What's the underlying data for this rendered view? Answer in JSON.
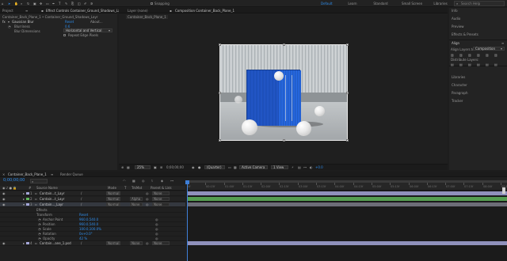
{
  "colors": {
    "accent": "#2d8ceb",
    "bg": "#1d1d1d",
    "panel": "#232323",
    "container_blue": "#1f56c4",
    "layer_green": "#5fb55a",
    "layer_purple": "#a4a6d8",
    "track_gray": "#6d6d78",
    "playhead": "#3e7fd8"
  },
  "top_toolbar": {
    "tools": [
      "home-icon",
      "selection-tool-icon",
      "hand-tool-icon",
      "zoom-tool-icon",
      "rotate-tool-icon",
      "camera-tool-icon",
      "pan-behind-tool-icon",
      "rectangle-tool-icon",
      "pen-tool-icon",
      "type-tool-icon",
      "brush-tool-icon",
      "clone-stamp-tool-icon",
      "eraser-tool-icon",
      "roto-brush-tool-icon",
      "puppet-tool-icon"
    ],
    "snapping_label": "Snapping",
    "workspaces": [
      "Default",
      "Learn",
      "Standard",
      "Small Screen",
      "Libraries"
    ],
    "search_label": "Search Help"
  },
  "left_panel": {
    "tabs": [
      "Project",
      "Effect Controls Container_Ground_Shadows_Layr"
    ],
    "breadcrumb": "Container_Back_Plane_1 • Container_Ground_Shadows_Layr",
    "effect": {
      "name": "Gaussian Blur",
      "reset": "Reset",
      "about": "About...",
      "params": [
        {
          "label": "Blurriness",
          "value": "0.6"
        },
        {
          "label": "Blur Dimensions",
          "value": "Horizontal and Vertical"
        }
      ],
      "checkbox_label": "Repeat Edge Pixels"
    }
  },
  "center_panel": {
    "tabs": [
      "Layer (none)",
      "Composition Container_Back_Plane_1"
    ],
    "sub_tab": "Container_Back_Plane_1",
    "bottom_bar": {
      "zoom": "25%",
      "timecode": "0;00;00;00",
      "resolution": "(Quarter)",
      "camera": "Active Camera",
      "views": "1 View",
      "exposure": "+0.0"
    }
  },
  "right_panel": {
    "items_top": [
      "Info",
      "Audio",
      "Preview",
      "Effects & Presets"
    ],
    "align": {
      "title": "Align",
      "align_layers_to_label": "Align Layers to:",
      "align_layers_to_value": "Composition",
      "distribute_label": "Distribute Layers:"
    },
    "items_bottom": [
      "Libraries",
      "Character",
      "Paragraph",
      "Tracker"
    ]
  },
  "timeline": {
    "tabs": [
      "Container_Back_Plane_1",
      "Render Queue"
    ],
    "timecode": "0;00;00;00",
    "search_placeholder": "",
    "columns": [
      "#",
      "Source Name",
      "Mode",
      "T",
      "TrkMat",
      "Parent & Link"
    ],
    "layers": [
      {
        "num": "1",
        "name": "Contain...t_Layr",
        "mode": "Normal",
        "trkmat": "",
        "parent": "None",
        "color": "#a4a6d8"
      },
      {
        "num": "2",
        "name": "Contain...t_Layr",
        "mode": "Normal",
        "trkmat": "Alpha",
        "parent": "None",
        "color": "#5fb55a"
      },
      {
        "num": "3",
        "name": "Contain..._Layr",
        "mode": "Normal",
        "trkmat": "None",
        "parent": "None",
        "color": "#a4a6d8"
      }
    ],
    "effects_label": "Effects",
    "transform": {
      "label": "Transform",
      "reset": "Reset",
      "props": [
        {
          "label": "Anchor Point",
          "value": "960.0,540.0"
        },
        {
          "label": "Position",
          "value": "960.0,540.0"
        },
        {
          "label": "Scale",
          "value": "100.0,100.0%"
        },
        {
          "label": "Rotation",
          "value": "0x+0.0°"
        },
        {
          "label": "Opacity",
          "value": "42 %"
        }
      ]
    },
    "last_layer": {
      "num": "4",
      "name": "Contain...ane_1.psd",
      "mode": "Normal",
      "trkmat": "None",
      "parent": "None"
    },
    "ruler_labels": [
      "0f",
      "00:15f",
      "01:00f",
      "01:15f",
      "02:00f",
      "02:15f",
      "03:00f",
      "03:15f",
      "04:00f",
      "04:15f",
      "05:00f",
      "05:15f",
      "06:00f",
      "06:15f",
      "07:00f",
      "07:15f",
      "08:00f",
      "08:15f"
    ]
  }
}
